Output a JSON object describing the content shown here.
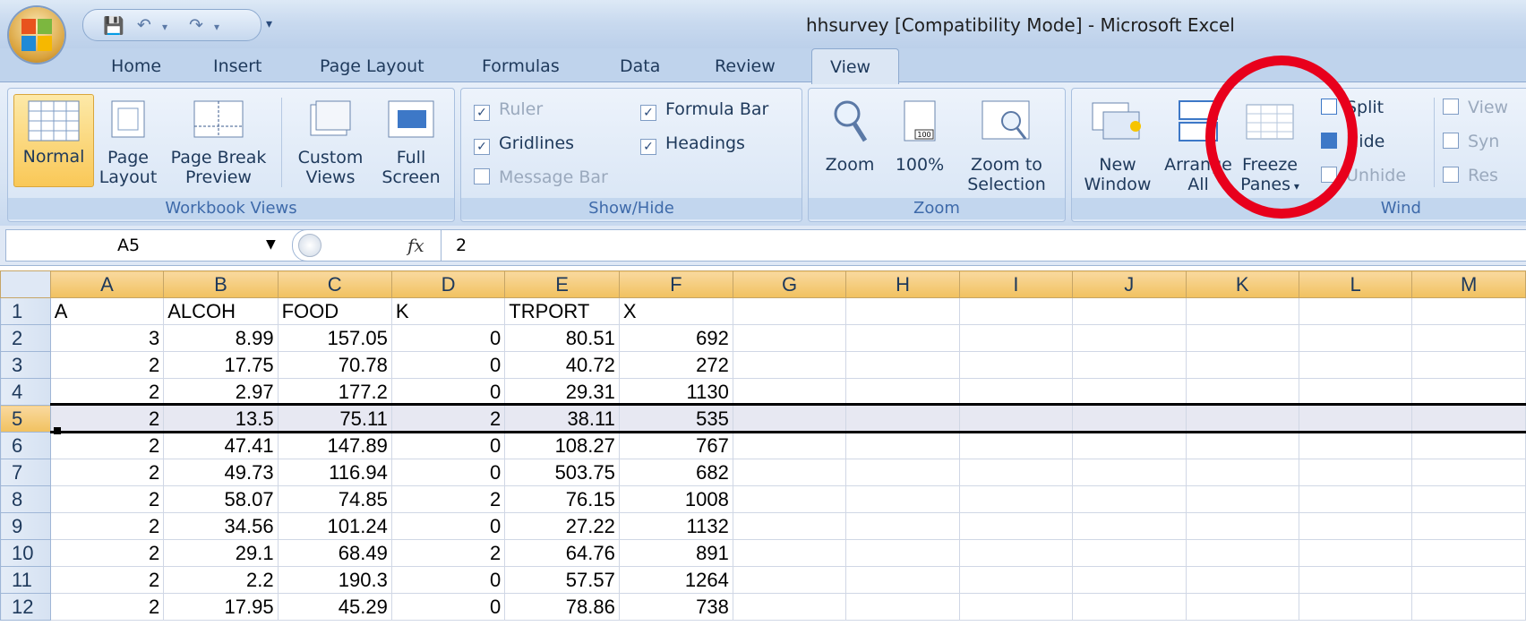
{
  "window": {
    "title": "hhsurvey  [Compatibility Mode] - Microsoft Excel"
  },
  "tabs": [
    "Home",
    "Insert",
    "Page Layout",
    "Formulas",
    "Data",
    "Review",
    "View"
  ],
  "active_tab": "View",
  "ribbon": {
    "workbook_views": {
      "label": "Workbook Views",
      "normal": "Normal",
      "page_layout": [
        "Page",
        "Layout"
      ],
      "page_break_preview": [
        "Page Break",
        "Preview"
      ],
      "custom_views": [
        "Custom",
        "Views"
      ],
      "full_screen": [
        "Full",
        "Screen"
      ]
    },
    "show_hide": {
      "label": "Show/Hide",
      "ruler": "Ruler",
      "gridlines": "Gridlines",
      "message_bar": "Message Bar",
      "formula_bar": "Formula Bar",
      "headings": "Headings"
    },
    "zoom": {
      "label": "Zoom",
      "zoom": "Zoom",
      "hundred": "100%",
      "zoom_to_selection": [
        "Zoom to",
        "Selection"
      ]
    },
    "window": {
      "label": "Wind",
      "new_window": [
        "New",
        "Window"
      ],
      "arrange_all": [
        "Arrange",
        "All"
      ],
      "freeze_panes": [
        "Freeze",
        "Panes"
      ],
      "split": "Split",
      "hide": "Hide",
      "unhide": "Unhide",
      "view_side": "View",
      "sync": "Syn",
      "reset": "Res"
    }
  },
  "formula_bar": {
    "name_box": "A5",
    "fx": "fx",
    "value": "2"
  },
  "sheet": {
    "columns": [
      "A",
      "B",
      "C",
      "D",
      "E",
      "F",
      "G",
      "H",
      "I",
      "J",
      "K",
      "L",
      "M"
    ],
    "rows": [
      {
        "n": "1",
        "cells": [
          "A",
          "ALCOH",
          "FOOD",
          "K",
          "TRPORT",
          "X",
          "",
          "",
          "",
          "",
          "",
          "",
          ""
        ]
      },
      {
        "n": "2",
        "cells": [
          "3",
          "8.99",
          "157.05",
          "0",
          "80.51",
          "692",
          "",
          "",
          "",
          "",
          "",
          "",
          ""
        ]
      },
      {
        "n": "3",
        "cells": [
          "2",
          "17.75",
          "70.78",
          "0",
          "40.72",
          "272",
          "",
          "",
          "",
          "",
          "",
          "",
          ""
        ]
      },
      {
        "n": "4",
        "cells": [
          "2",
          "2.97",
          "177.2",
          "0",
          "29.31",
          "1130",
          "",
          "",
          "",
          "",
          "",
          "",
          ""
        ]
      },
      {
        "n": "5",
        "cells": [
          "2",
          "13.5",
          "75.11",
          "2",
          "38.11",
          "535",
          "",
          "",
          "",
          "",
          "",
          "",
          ""
        ]
      },
      {
        "n": "6",
        "cells": [
          "2",
          "47.41",
          "147.89",
          "0",
          "108.27",
          "767",
          "",
          "",
          "",
          "",
          "",
          "",
          ""
        ]
      },
      {
        "n": "7",
        "cells": [
          "2",
          "49.73",
          "116.94",
          "0",
          "503.75",
          "682",
          "",
          "",
          "",
          "",
          "",
          "",
          ""
        ]
      },
      {
        "n": "8",
        "cells": [
          "2",
          "58.07",
          "74.85",
          "2",
          "76.15",
          "1008",
          "",
          "",
          "",
          "",
          "",
          "",
          ""
        ]
      },
      {
        "n": "9",
        "cells": [
          "2",
          "34.56",
          "101.24",
          "0",
          "27.22",
          "1132",
          "",
          "",
          "",
          "",
          "",
          "",
          ""
        ]
      },
      {
        "n": "10",
        "cells": [
          "2",
          "29.1",
          "68.49",
          "2",
          "64.76",
          "891",
          "",
          "",
          "",
          "",
          "",
          "",
          ""
        ]
      },
      {
        "n": "11",
        "cells": [
          "2",
          "2.2",
          "190.3",
          "0",
          "57.57",
          "1264",
          "",
          "",
          "",
          "",
          "",
          "",
          ""
        ]
      },
      {
        "n": "12",
        "cells": [
          "2",
          "17.95",
          "45.29",
          "0",
          "78.86",
          "738",
          "",
          "",
          "",
          "",
          "",
          "",
          ""
        ]
      }
    ],
    "selected_row": "5"
  },
  "annotation": {
    "color": "#e8001c",
    "target": "freeze-panes-button"
  }
}
